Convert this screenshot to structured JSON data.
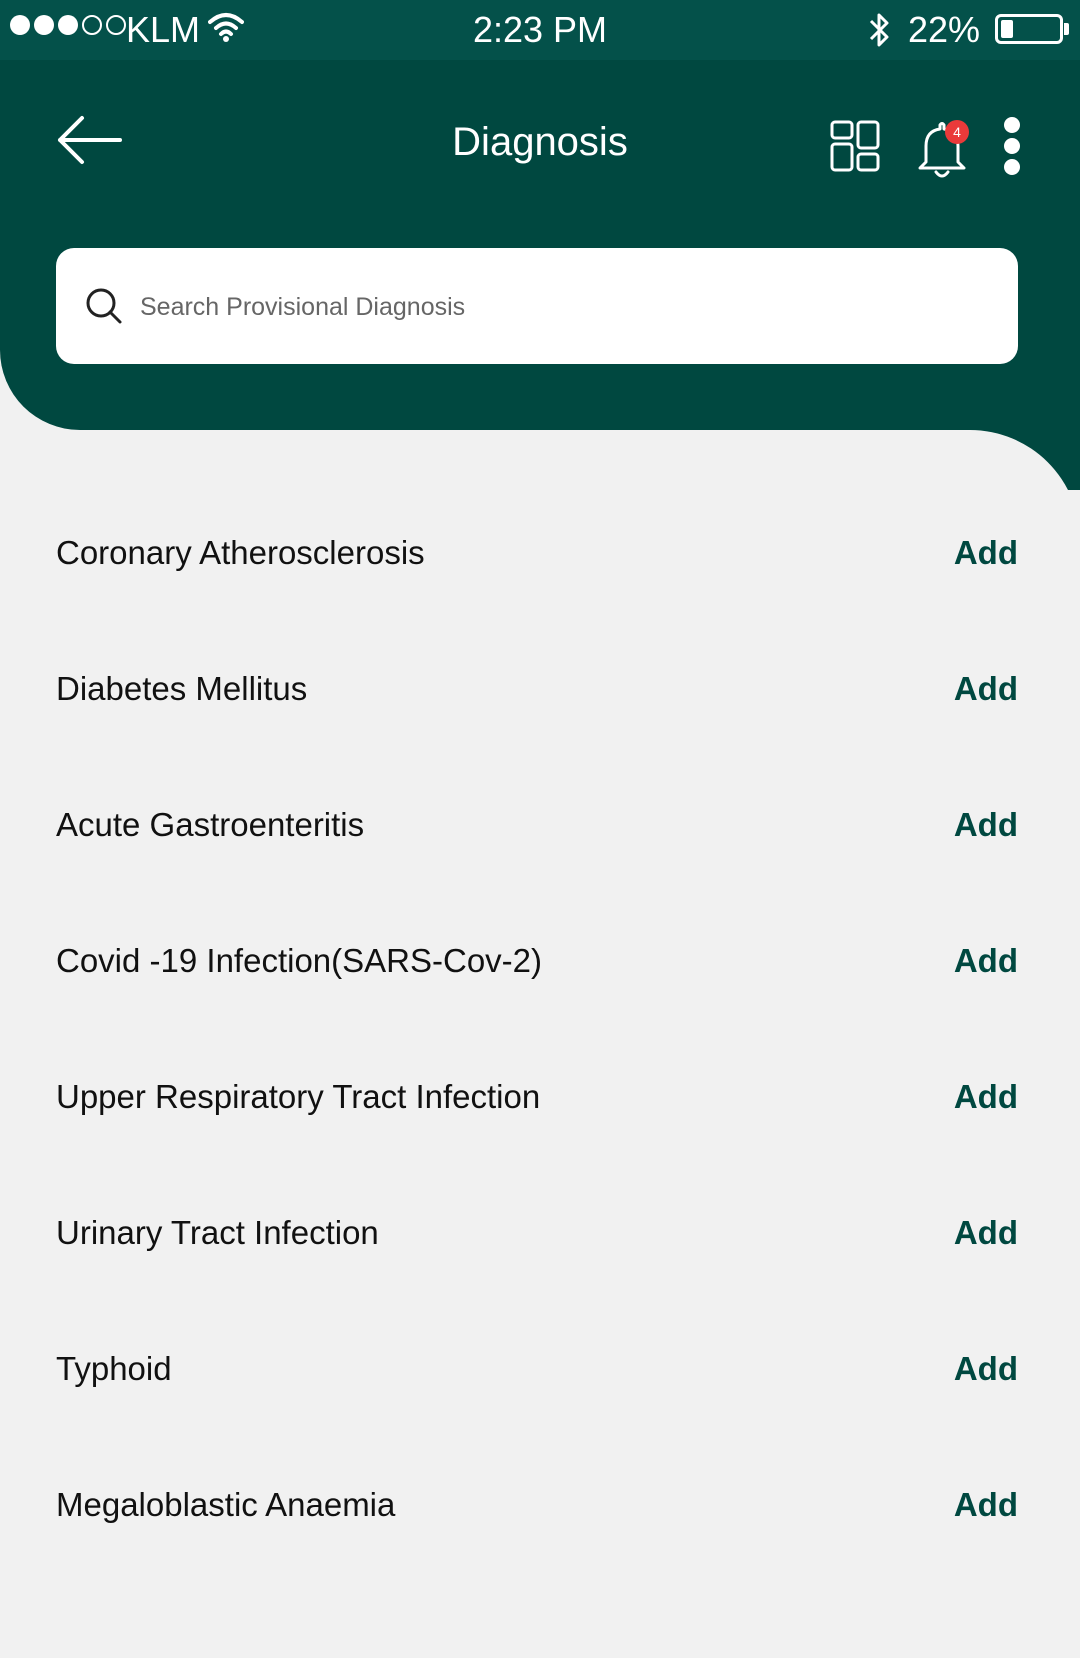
{
  "status_bar": {
    "carrier": "KLM",
    "time": "2:23 PM",
    "battery_percent": "22%",
    "battery_level": 0.22,
    "signal_bars_filled": 3,
    "signal_bars_total": 5
  },
  "header": {
    "title": "Diagnosis",
    "notification_count": "4",
    "icons": [
      "back-arrow-icon",
      "dashboard-grid-icon",
      "bell-icon",
      "more-vertical-icon"
    ]
  },
  "search": {
    "placeholder": "Search Provisional Diagnosis",
    "value": ""
  },
  "diagnoses": [
    {
      "name": "Coronary Atherosclerosis",
      "action": "Add"
    },
    {
      "name": "Diabetes Mellitus",
      "action": "Add"
    },
    {
      "name": "Acute Gastroenteritis",
      "action": "Add"
    },
    {
      "name": "Covid -19 Infection(SARS-Cov-2)",
      "action": "Add"
    },
    {
      "name": "Upper Respiratory Tract Infection",
      "action": "Add"
    },
    {
      "name": "Urinary Tract Infection",
      "action": "Add"
    },
    {
      "name": "Typhoid",
      "action": "Add"
    },
    {
      "name": "Megaloblastic Anaemia",
      "action": "Add"
    }
  ],
  "colors": {
    "header_bg": "#004840",
    "status_bg": "#04514a",
    "accent": "#004840",
    "badge": "#ea3a3a",
    "page_bg": "#f1f1f1"
  }
}
